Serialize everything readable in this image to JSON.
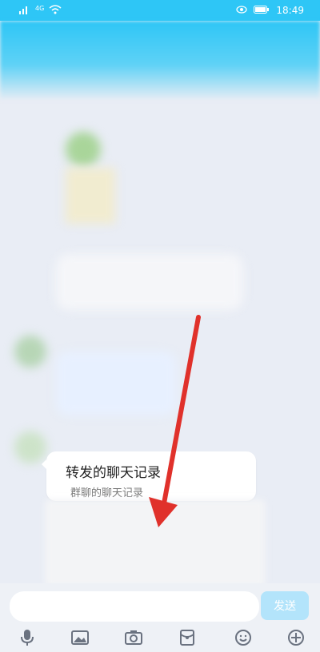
{
  "status_bar": {
    "signal_label": "4G",
    "time": "18:49",
    "icons": [
      "signal-icon",
      "wifi-icon",
      "eye-icon",
      "battery-icon"
    ]
  },
  "card": {
    "title": "转发的聊天记录",
    "subtitle": "群聊的聊天记录"
  },
  "input": {
    "placeholder": ""
  },
  "send_label": "发送",
  "toolbar": {
    "items": [
      "mic-icon",
      "image-icon",
      "camera-icon",
      "red-packet-icon",
      "emoji-icon",
      "plus-icon"
    ]
  },
  "colors": {
    "accent": "#2ec6f6",
    "arrow": "#e0312b",
    "send_bg": "#b3e4fb"
  }
}
